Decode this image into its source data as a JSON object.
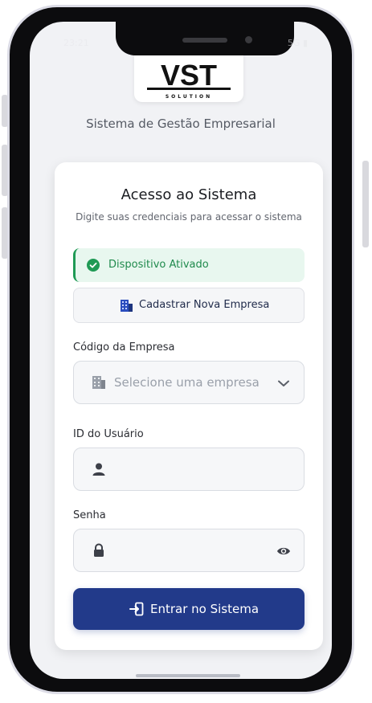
{
  "status": {
    "time": "23:21",
    "icons": "5G ▮"
  },
  "logo": {
    "text": "VST",
    "subtitle": "SOLUTION"
  },
  "app_subtitle": "Sistema de Gestão Empresarial",
  "card": {
    "title": "Acesso ao Sistema",
    "description": "Digite suas credenciais para acessar o sistema",
    "alert_text": "Dispositivo Ativado",
    "register_button": "Cadastrar Nova Empresa",
    "company_label": "Código da Empresa",
    "company_placeholder": "Selecione uma empresa",
    "user_label": "ID do Usuário",
    "user_value": "",
    "password_label": "Senha",
    "password_value": "",
    "submit_button": "Entrar no Sistema"
  },
  "colors": {
    "primary": "#223a8a",
    "success": "#1f9a55",
    "background": "#f1f2f5"
  },
  "icons": [
    "check-circle-icon",
    "building-icon",
    "chevron-down-icon",
    "user-icon",
    "lock-icon",
    "eye-icon",
    "login-icon"
  ]
}
